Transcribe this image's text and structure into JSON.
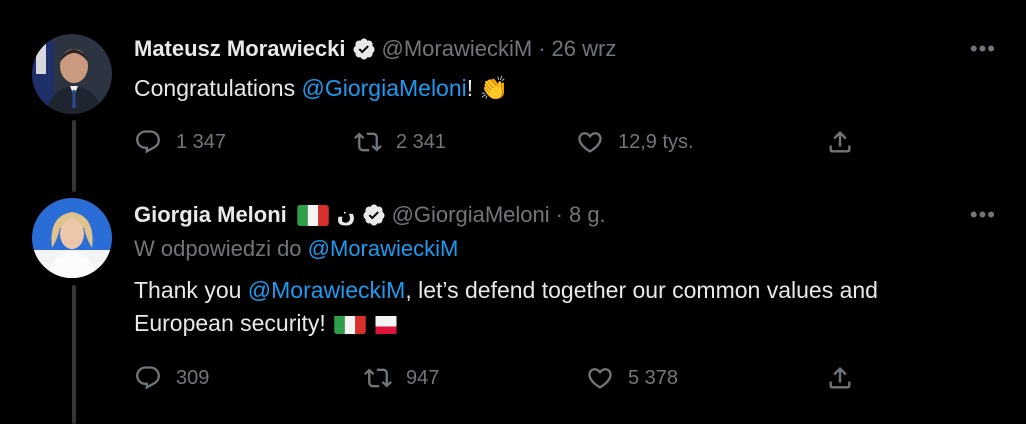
{
  "tweets": [
    {
      "author_name": "Mateusz Morawiecki",
      "handle": "@MorawieckiM",
      "time": "26 wrz",
      "more": "•••",
      "text_prefix": "Congratulations ",
      "mention": "@GiorgiaMeloni",
      "text_suffix": "!",
      "emoji": "👏",
      "replies": "1 347",
      "retweets": "2 341",
      "likes": "12,9 tys."
    },
    {
      "author_name": "Giorgia Meloni",
      "name_extra": "ن",
      "handle": "@GiorgiaMeloni",
      "time": "8 g.",
      "more": "•••",
      "reply_to_label": "W odpowiedzi do ",
      "reply_to_handle": "@MorawieckiM",
      "text_line1_prefix": "Thank you ",
      "text_line1_mention": "@MorawieckiM",
      "text_line1_suffix": ", let’s defend together our common values and",
      "text_line2": "European security! ",
      "replies": "309",
      "retweets": "947",
      "likes": "5 378"
    }
  ],
  "colors": {
    "background": "#000000",
    "text": "#e7e9ea",
    "muted": "#71767b",
    "link": "#1d9bf0",
    "thread_line": "#333639"
  },
  "icons": [
    "verified-badge-icon",
    "reply-icon",
    "retweet-icon",
    "like-icon",
    "share-icon",
    "more-icon",
    "italy-flag-icon",
    "poland-flag-icon",
    "clapping-hands-icon"
  ]
}
